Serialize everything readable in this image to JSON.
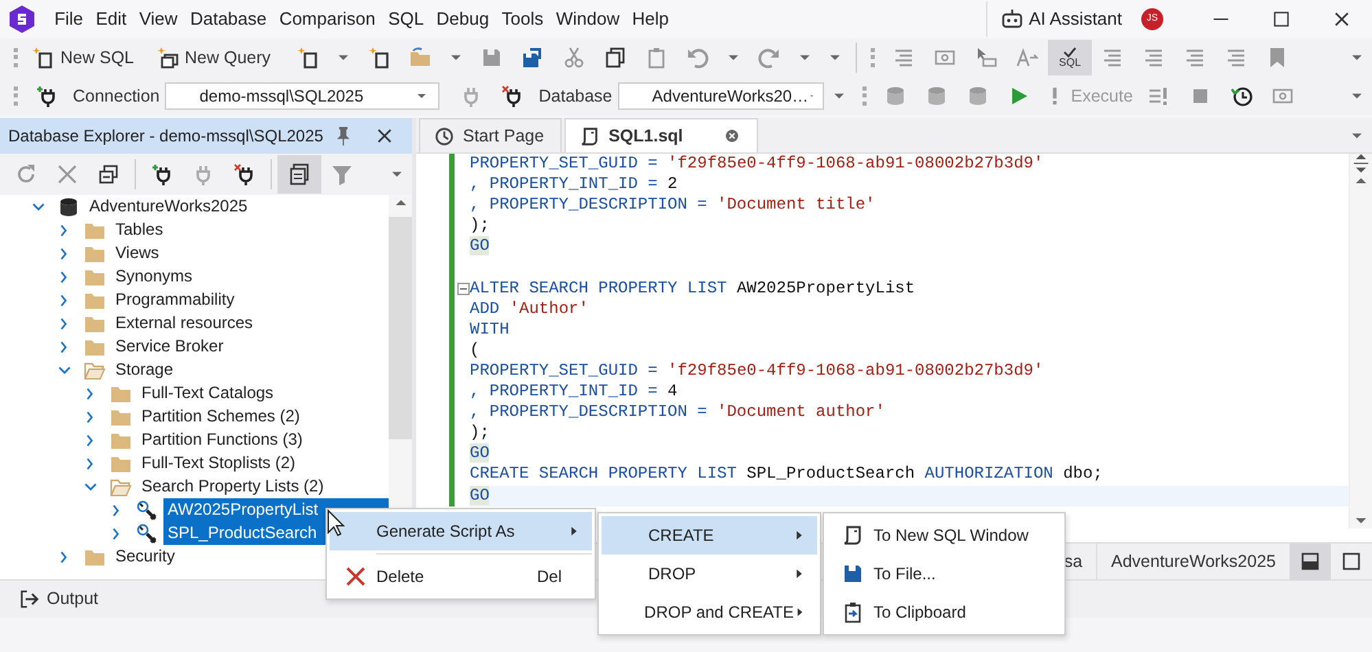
{
  "menu_bar": {
    "items": [
      "File",
      "Edit",
      "View",
      "Database",
      "Comparison",
      "SQL",
      "Debug",
      "Tools",
      "Window",
      "Help"
    ],
    "ai_assistant": "AI Assistant",
    "avatar": "JS"
  },
  "toolbar_1": {
    "buttons": [
      "New SQL",
      "New Query"
    ],
    "sql_toggle": {
      "label": "SQL",
      "pressed": true
    }
  },
  "toolbar_2": {
    "connection_label": "Connection",
    "connection_value": "demo-mssql\\SQL2025",
    "database_label": "Database",
    "database_value": "AdventureWorks20…",
    "execute": {
      "label": "Execute",
      "disabled": true
    }
  },
  "explorer": {
    "title": "Database Explorer - demo-mssql\\SQL2025",
    "toggle_pressed": true,
    "tree": [
      {
        "label": "AdventureWorks2025",
        "kind": "database",
        "expanded": true,
        "selected": false,
        "children": [
          {
            "label": "Tables",
            "kind": "folder",
            "expanded": false,
            "selected": false
          },
          {
            "label": "Views",
            "kind": "folder",
            "expanded": false,
            "selected": false
          },
          {
            "label": "Synonyms",
            "kind": "folder",
            "expanded": false,
            "selected": false
          },
          {
            "label": "Programmability",
            "kind": "folder",
            "expanded": false,
            "selected": false
          },
          {
            "label": "External resources",
            "kind": "folder",
            "expanded": false,
            "selected": false
          },
          {
            "label": "Service Broker",
            "kind": "folder",
            "expanded": false,
            "selected": false
          },
          {
            "label": "Storage",
            "kind": "folder",
            "expanded": true,
            "selected": false,
            "children": [
              {
                "label": "Full-Text Catalogs",
                "kind": "folder",
                "expanded": false,
                "selected": false
              },
              {
                "label": "Partition Schemes (2)",
                "kind": "folder",
                "expanded": false,
                "selected": false
              },
              {
                "label": "Partition Functions (3)",
                "kind": "folder",
                "expanded": false,
                "selected": false
              },
              {
                "label": "Full-Text Stoplists (2)",
                "kind": "folder",
                "expanded": false,
                "selected": false
              },
              {
                "label": "Search Property Lists (2)",
                "kind": "folder",
                "expanded": true,
                "selected": false,
                "children": [
                  {
                    "label": "AW2025PropertyList",
                    "kind": "property-list",
                    "expanded": false,
                    "selected": true
                  },
                  {
                    "label": "SPL_ProductSearch",
                    "kind": "property-list",
                    "expanded": false,
                    "selected": true
                  }
                ]
              }
            ]
          },
          {
            "label": "Security",
            "kind": "folder",
            "expanded": false,
            "selected": false
          }
        ]
      }
    ]
  },
  "editor": {
    "tabs": [
      {
        "label": "Start Page",
        "selected": false
      },
      {
        "label": "SQL1.sql",
        "selected": true
      }
    ],
    "lines": [
      {
        "modified": true,
        "current": false,
        "fold": false,
        "tokens": [
          {
            "kind": "kw",
            "text": "PROPERTY_SET_GUID = "
          },
          {
            "kind": "str",
            "text": "'f29f85e0-4ff9-1068-ab91-08002b27b3d9'"
          }
        ]
      },
      {
        "modified": true,
        "current": false,
        "fold": false,
        "tokens": [
          {
            "kind": "kw",
            "text": ", PROPERTY_INT_ID = "
          },
          {
            "kind": "txt",
            "text": "2"
          }
        ]
      },
      {
        "modified": true,
        "current": false,
        "fold": false,
        "tokens": [
          {
            "kind": "kw",
            "text": ", PROPERTY_DESCRIPTION = "
          },
          {
            "kind": "str",
            "text": "'Document title'"
          }
        ]
      },
      {
        "modified": true,
        "current": false,
        "fold": false,
        "tokens": [
          {
            "kind": "txt",
            "text": ");"
          }
        ]
      },
      {
        "modified": true,
        "current": false,
        "fold": false,
        "tokens": [
          {
            "kind": "go",
            "text": "GO"
          }
        ]
      },
      {
        "modified": true,
        "current": false,
        "fold": false
      },
      {
        "modified": true,
        "current": false,
        "fold": true,
        "tokens": [
          {
            "kind": "kw",
            "text": "ALTER SEARCH PROPERTY LIST "
          },
          {
            "kind": "txt",
            "text": "AW2025PropertyList"
          }
        ]
      },
      {
        "modified": true,
        "current": false,
        "fold": false,
        "tokens": [
          {
            "kind": "kw",
            "text": "ADD "
          },
          {
            "kind": "str",
            "text": "'Author'"
          }
        ]
      },
      {
        "modified": true,
        "current": false,
        "fold": false,
        "tokens": [
          {
            "kind": "kw",
            "text": "WITH"
          }
        ]
      },
      {
        "modified": true,
        "current": false,
        "fold": false,
        "tokens": [
          {
            "kind": "txt",
            "text": "("
          }
        ]
      },
      {
        "modified": true,
        "current": false,
        "fold": false,
        "tokens": [
          {
            "kind": "kw",
            "text": "PROPERTY_SET_GUID = "
          },
          {
            "kind": "str",
            "text": "'f29f85e0-4ff9-1068-ab91-08002b27b3d9'"
          }
        ]
      },
      {
        "modified": true,
        "current": false,
        "fold": false,
        "tokens": [
          {
            "kind": "kw",
            "text": ", PROPERTY_INT_ID = "
          },
          {
            "kind": "txt",
            "text": "4"
          }
        ]
      },
      {
        "modified": true,
        "current": false,
        "fold": false,
        "tokens": [
          {
            "kind": "kw",
            "text": ", PROPERTY_DESCRIPTION = "
          },
          {
            "kind": "str",
            "text": "'Document author'"
          }
        ]
      },
      {
        "modified": true,
        "current": false,
        "fold": false,
        "tokens": [
          {
            "kind": "txt",
            "text": ");"
          }
        ]
      },
      {
        "modified": true,
        "current": false,
        "fold": false,
        "tokens": [
          {
            "kind": "go",
            "text": "GO"
          }
        ]
      },
      {
        "modified": true,
        "current": false,
        "fold": false,
        "tokens": [
          {
            "kind": "kw",
            "text": "CREATE SEARCH PROPERTY LIST "
          },
          {
            "kind": "txt",
            "text": "SPL_ProductSearch "
          },
          {
            "kind": "kw",
            "text": "AUTHORIZATION "
          },
          {
            "kind": "txt",
            "text": "dbo;"
          }
        ]
      },
      {
        "modified": true,
        "current": true,
        "fold": false,
        "tokens": [
          {
            "kind": "go",
            "text": "GO"
          }
        ]
      }
    ]
  },
  "status": {
    "items": [
      "sa",
      "AdventureWorks2025"
    ],
    "layout_toggle_pressed": true
  },
  "output": {
    "label": "Output"
  },
  "context_menus": [
    {
      "items": [
        {
          "label": "Generate Script As",
          "kind": "plain",
          "submenu": true,
          "selected": true
        },
        {
          "label": "Delete",
          "kind": "delete",
          "shortcut": "Del",
          "submenu": false,
          "selected": false
        }
      ]
    },
    {
      "items": [
        {
          "label": "CREATE",
          "kind": "plain",
          "submenu": true,
          "selected": true
        },
        {
          "label": "DROP",
          "kind": "plain",
          "submenu": true,
          "selected": false
        },
        {
          "label": "DROP and CREATE",
          "kind": "plain",
          "submenu": true,
          "selected": false
        }
      ]
    },
    {
      "items": [
        {
          "label": "To New SQL Window",
          "kind": "new-window",
          "submenu": false,
          "selected": false
        },
        {
          "label": "To File...",
          "kind": "file",
          "submenu": false,
          "selected": false
        },
        {
          "label": "To Clipboard",
          "kind": "clipboard",
          "submenu": false,
          "selected": false
        }
      ]
    }
  ]
}
